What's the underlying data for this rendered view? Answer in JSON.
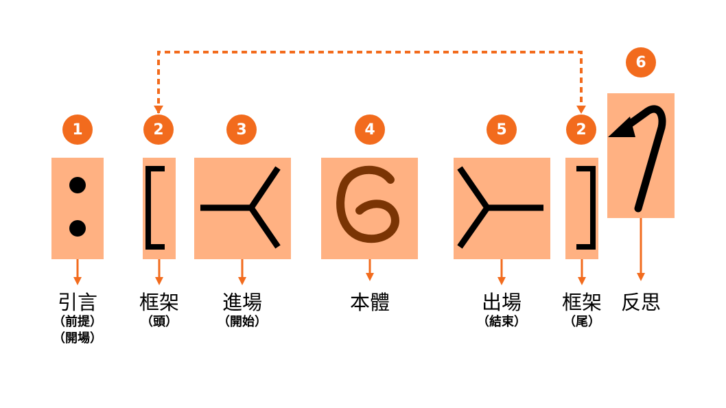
{
  "colors": {
    "accent": "#F26B1D",
    "box_fill": "#FFB182",
    "glyph": "#000000",
    "glyph_body": "#7A3404"
  },
  "stages": [
    {
      "number": "1",
      "name": "引言",
      "subs": [
        "（前提）",
        "（開場）"
      ],
      "glyph": "colon-icon"
    },
    {
      "number": "2",
      "name": "框架",
      "subs": [
        "（頭）"
      ],
      "glyph": "open-bracket-icon"
    },
    {
      "number": "3",
      "name": "進場",
      "subs": [
        "（開始）"
      ],
      "glyph": "converge-y-icon"
    },
    {
      "number": "4",
      "name": "本體",
      "subs": [],
      "glyph": "g-spiral-icon"
    },
    {
      "number": "5",
      "name": "出場",
      "subs": [
        "（結束）"
      ],
      "glyph": "diverge-y-icon"
    },
    {
      "number": "2",
      "name": "框架",
      "subs": [
        "（尾）"
      ],
      "glyph": "close-bracket-icon"
    },
    {
      "number": "6",
      "name": "反思",
      "subs": [],
      "glyph": "return-arrow-icon"
    }
  ]
}
